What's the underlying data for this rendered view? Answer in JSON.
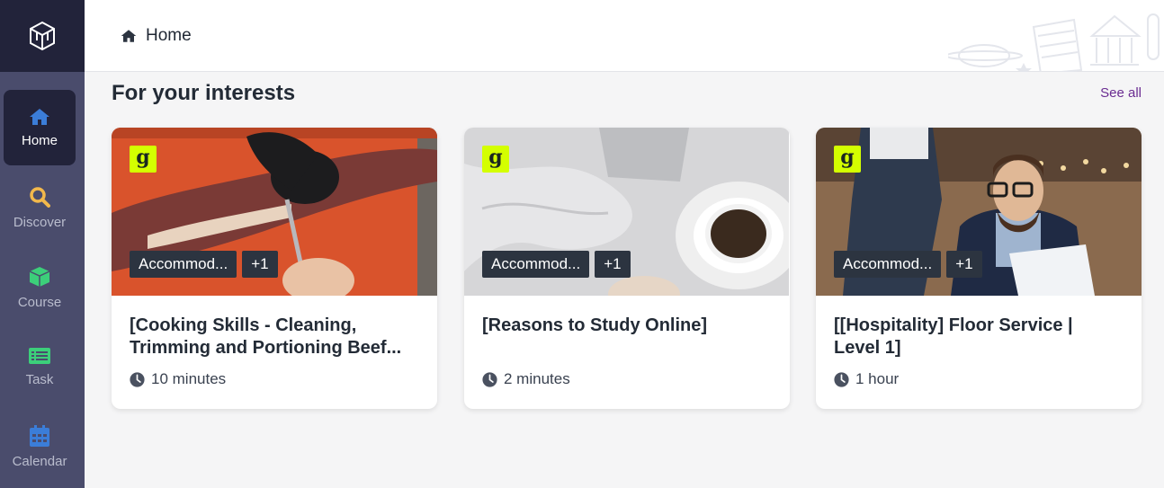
{
  "sidebar": {
    "items": [
      {
        "label": "Home",
        "icon": "home-icon",
        "color": "#3b7dd8",
        "active": true
      },
      {
        "label": "Discover",
        "icon": "search-icon",
        "color": "#f2b84b"
      },
      {
        "label": "Course",
        "icon": "cube-icon",
        "color": "#3ccf7a"
      },
      {
        "label": "Task",
        "icon": "list-icon",
        "color": "#3ccf7a"
      },
      {
        "label": "Calendar",
        "icon": "calendar-icon",
        "color": "#3b7dd8"
      }
    ]
  },
  "header": {
    "breadcrumb": "Home"
  },
  "main": {
    "section_title": "For your interests",
    "see_all": "See all",
    "cards": [
      {
        "badge": "g",
        "tag": "Accommod...",
        "tag_more": "+1",
        "title": "[Cooking Skills - Cleaning, Trimming and Portioning Beef...",
        "duration": "10 minutes"
      },
      {
        "badge": "g",
        "tag": "Accommod...",
        "tag_more": "+1",
        "title": "[Reasons to Study Online]",
        "duration": "2 minutes"
      },
      {
        "badge": "g",
        "tag": "Accommod...",
        "tag_more": "+1",
        "title": "[[Hospitality] Floor Service | Level 1]",
        "duration": "1 hour"
      }
    ]
  },
  "colors": {
    "sidebar_bg": "#4a4c6c",
    "sidebar_dark": "#22233a",
    "accent_link": "#6a2c91",
    "badge_bg": "#d4ff00"
  }
}
